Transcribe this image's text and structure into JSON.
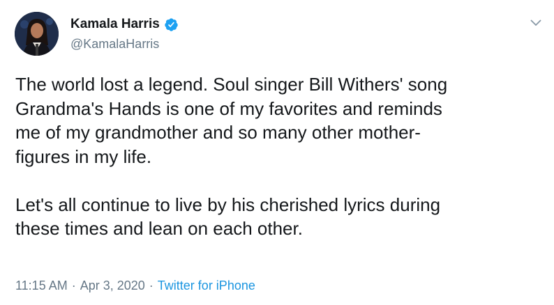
{
  "author": {
    "name": "Kamala Harris",
    "handle": "@KamalaHarris",
    "avatar_icon": "profile-photo",
    "verified_icon": "verified-badge-icon"
  },
  "tweet": {
    "text": "The world lost a legend. Soul singer Bill Withers' song\nGrandma's Hands is one of my favorites and reminds\nme of my grandmother and so many other mother-\nfigures in my life.\n\nLet's all continue to live by his cherished lyrics during\nthese times and lean on each other.",
    "time": "11:15 AM",
    "separator_1": "·",
    "date": "Apr 3, 2020",
    "separator_2": "·",
    "source": "Twitter for iPhone"
  },
  "menu": {
    "icon": "chevron-down-icon"
  },
  "colors": {
    "text": "#14171a",
    "secondary": "#657786",
    "link": "#1b95e0",
    "verified": "#1da1f2"
  }
}
